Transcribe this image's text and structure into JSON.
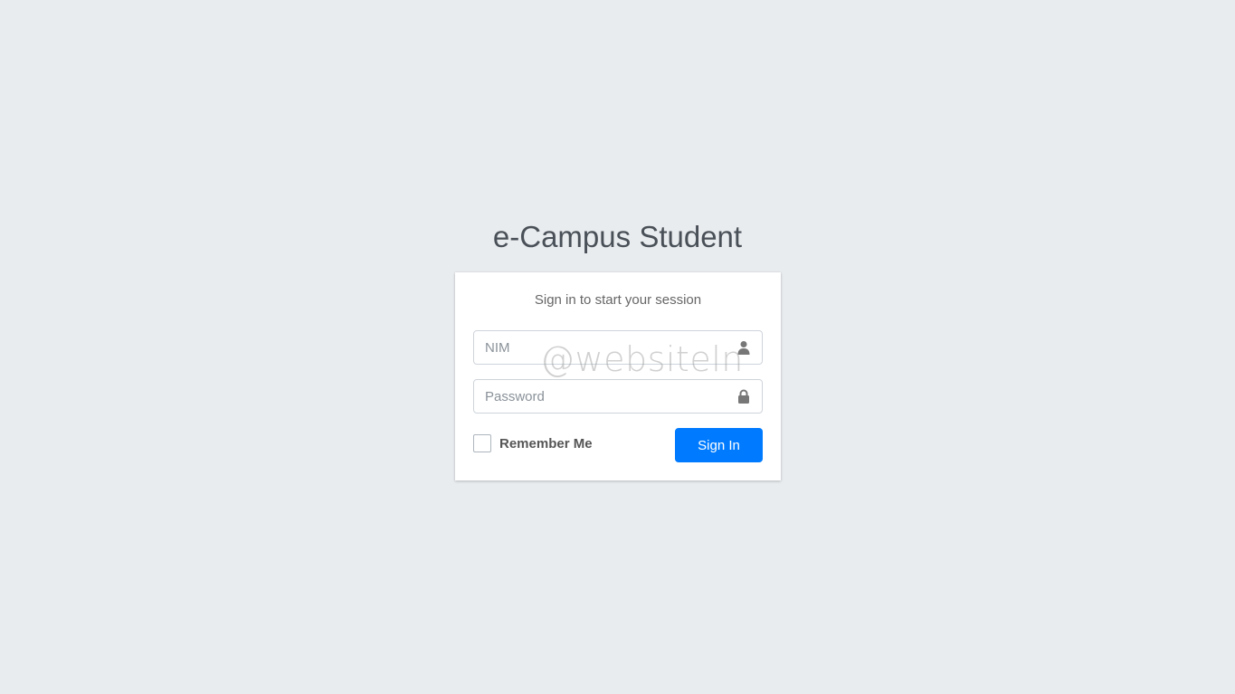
{
  "logo": {
    "brand": "e-Campus",
    "sub": "Student"
  },
  "login_box": {
    "message": "Sign in to start your session",
    "nim": {
      "placeholder": "NIM",
      "value": "",
      "icon": "user-icon"
    },
    "password": {
      "placeholder": "Password",
      "value": "",
      "icon": "lock-icon"
    },
    "remember_label": "Remember Me",
    "remember_checked": false,
    "signin_label": "Sign In"
  },
  "watermark": "@websiteln",
  "colors": {
    "background": "#e9ecef",
    "primary": "#007bff",
    "icon": "#777777"
  }
}
